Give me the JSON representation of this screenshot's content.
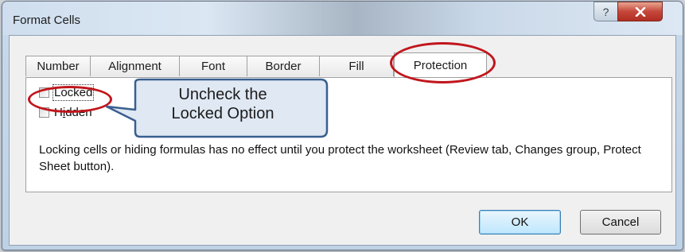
{
  "window": {
    "title": "Format Cells"
  },
  "titlebar_buttons": {
    "help": "?",
    "close": "✕"
  },
  "tabs": [
    {
      "label": "Number",
      "active": false
    },
    {
      "label": "Alignment",
      "active": false
    },
    {
      "label": "Font",
      "active": false
    },
    {
      "label": "Border",
      "active": false
    },
    {
      "label": "Fill",
      "active": false
    },
    {
      "label": "Protection",
      "active": true
    }
  ],
  "protection": {
    "locked": {
      "label": "Locked",
      "checked": false
    },
    "hidden": {
      "label_prefix": "H",
      "label_underlined": "i",
      "label_suffix": "dden",
      "checked": false
    },
    "info_text": "Locking cells or hiding formulas has no effect until you protect the worksheet (Review tab, Changes group, Protect Sheet button)."
  },
  "buttons": {
    "ok": "OK",
    "cancel": "Cancel"
  },
  "callout": {
    "line1": "Uncheck the",
    "line2": "Locked Option"
  },
  "colors": {
    "annotation_red": "#c0161c",
    "callout_fill": "#dfe8f3",
    "callout_border": "#3a5f8f",
    "close_button": "#c5473b"
  }
}
